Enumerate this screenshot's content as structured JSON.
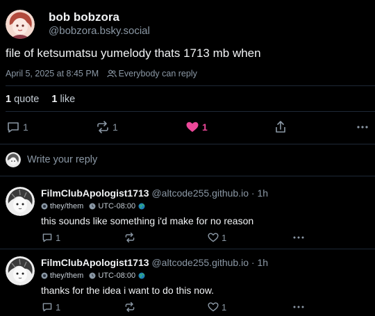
{
  "post": {
    "author_name": "bob bobzora",
    "author_handle": "@bobzora.bsky.social",
    "text": "file of ketsumatsu yumelody thats 1713 mb when",
    "timestamp": "April 5, 2025 at 8:45 PM",
    "reply_setting": "Everybody can reply",
    "quote_count": "1",
    "quote_label": "quote",
    "like_count": "1",
    "like_label": "like",
    "actions": {
      "replies": "1",
      "reposts": "1",
      "likes": "1"
    }
  },
  "composer": {
    "placeholder": "Write your reply"
  },
  "replies": [
    {
      "author_name": "FilmClubApologist1713",
      "author_handle": "@altcode255.github.io",
      "time": "· 1h",
      "pronouns": "they/them",
      "timezone": "UTC-08:00",
      "text": "this sounds like something i'd make for no reason",
      "replies": "1",
      "likes": "1"
    },
    {
      "author_name": "FilmClubApologist1713",
      "author_handle": "@altcode255.github.io",
      "time": "· 1h",
      "pronouns": "they/them",
      "timezone": "UTC-08:00",
      "text": "thanks for the idea i want to do this now.",
      "replies": "1",
      "likes": "1"
    }
  ],
  "colors": {
    "background": "#000000",
    "like_active": "#ec4899",
    "muted": "#8b98a5",
    "divider": "#1e2937"
  },
  "icons": [
    "avatar",
    "people-icon",
    "reply-icon",
    "repost-icon",
    "heart-filled-icon",
    "share-icon",
    "more-icon",
    "globe-icon",
    "badge-icon"
  ]
}
